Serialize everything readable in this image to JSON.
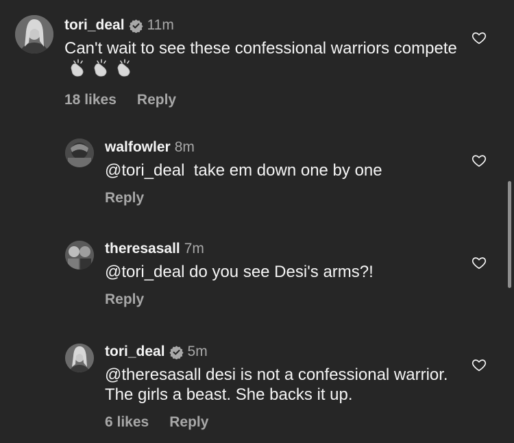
{
  "comments": [
    {
      "username": "tori_deal",
      "verified": true,
      "time": "11m",
      "text": "Can't wait to see these confessional warriors compete",
      "emoji": "clapping-hands",
      "likes": "18 likes",
      "reply": "Reply"
    },
    {
      "username": "walfowler",
      "verified": false,
      "time": "8m",
      "text": "@tori_deal  take em down one by one",
      "reply": "Reply"
    },
    {
      "username": "theresasall",
      "verified": false,
      "time": "7m",
      "text": "@tori_deal do you see Desi's arms?!",
      "reply": "Reply"
    },
    {
      "username": "tori_deal",
      "verified": true,
      "time": "5m",
      "text": "@theresasall desi is not a confessional warrior. The girls a beast. She backs it up.",
      "likes": "6 likes",
      "reply": "Reply"
    }
  ],
  "icons": {
    "like": "heart-outline-icon",
    "verified": "verified-badge-icon"
  },
  "colors": {
    "background": "#262626",
    "text": "#f5f5f5",
    "secondary": "#a8a8a8"
  }
}
